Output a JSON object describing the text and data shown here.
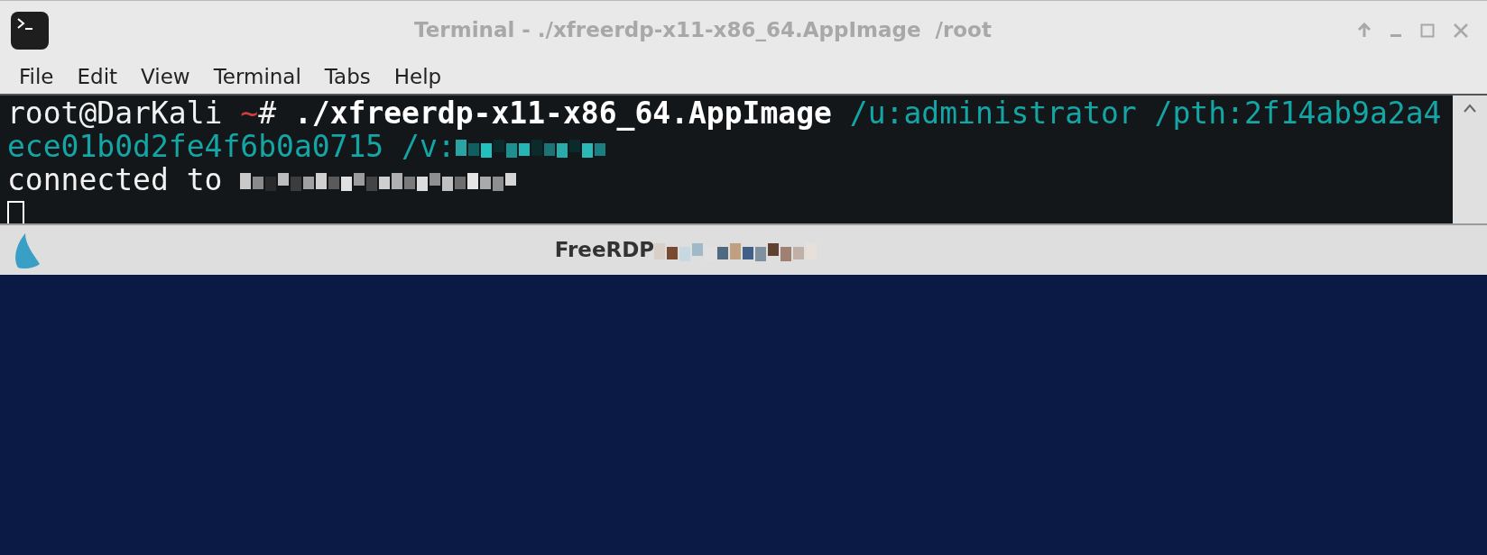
{
  "terminal_window": {
    "title": "Terminal - ./xfreerdp-x11-x86_64.AppImage  /root",
    "menu": [
      "File",
      "Edit",
      "View",
      "Terminal",
      "Tabs",
      "Help"
    ],
    "lines": [
      {
        "segments": [
          {
            "kind": "prompt",
            "text": "root@DarKali "
          },
          {
            "kind": "path",
            "text": "~"
          },
          {
            "kind": "prompt",
            "text": "# "
          },
          {
            "kind": "command",
            "text": "./xfreerdp-x11-x86_64.AppImage"
          },
          {
            "kind": "arg",
            "text": " /u:administrator /pth:2f14ab9a2a4"
          }
        ]
      },
      {
        "segments": [
          {
            "kind": "arg",
            "text": "ece01b0d2fe4f6b0a0715 /v:"
          },
          {
            "kind": "redacted-arg"
          }
        ]
      },
      {
        "segments": [
          {
            "kind": "output",
            "text": "connected to "
          },
          {
            "kind": "redacted-output"
          }
        ]
      },
      {
        "segments": [
          {
            "kind": "cursor"
          }
        ]
      }
    ]
  },
  "rdp_window": {
    "title": "FreeRDP"
  }
}
